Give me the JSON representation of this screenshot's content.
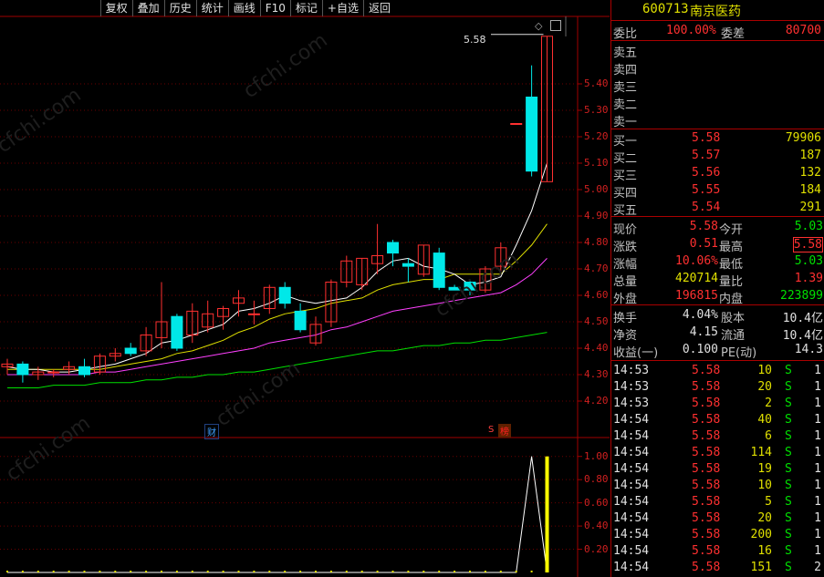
{
  "toolbar": {
    "items": [
      "复权",
      "叠加",
      "历史",
      "统计",
      "画线",
      "F10",
      "标记",
      "+自选",
      "返回"
    ]
  },
  "price_axis": [
    "5.40",
    "5.30",
    "5.20",
    "5.10",
    "5.00",
    "4.90",
    "4.80",
    "4.70",
    "4.60",
    "4.50",
    "4.40",
    "4.30",
    "4.20"
  ],
  "volume_axis": [
    "1.00",
    "0.80",
    "0.60",
    "0.40",
    "0.20"
  ],
  "price_marker": "5.58",
  "event_markers": {
    "fin": "财",
    "s": "S",
    "bang": "榜"
  },
  "watermark": "cfchi.com",
  "stock": {
    "code": "600713",
    "name": "南京医药"
  },
  "order_ratio": {
    "label_ratio": "委比",
    "ratio": "100.00%",
    "label_diff": "委差",
    "diff": "80700"
  },
  "sell_book": [
    {
      "label": "卖五",
      "price": "",
      "qty": ""
    },
    {
      "label": "卖四",
      "price": "",
      "qty": ""
    },
    {
      "label": "卖三",
      "price": "",
      "qty": ""
    },
    {
      "label": "卖二",
      "price": "",
      "qty": ""
    },
    {
      "label": "卖一",
      "price": "",
      "qty": ""
    }
  ],
  "buy_book": [
    {
      "label": "买一",
      "price": "5.58",
      "qty": "79906"
    },
    {
      "label": "买二",
      "price": "5.57",
      "qty": "187"
    },
    {
      "label": "买三",
      "price": "5.56",
      "qty": "132"
    },
    {
      "label": "买四",
      "price": "5.55",
      "qty": "184"
    },
    {
      "label": "买五",
      "price": "5.54",
      "qty": "291"
    }
  ],
  "quote": [
    {
      "l1": "现价",
      "v1": "5.58",
      "l2": "今开",
      "v2": "5.03",
      "c1": "#ff3030",
      "c2": "#00e000"
    },
    {
      "l1": "涨跌",
      "v1": "0.51",
      "l2": "最高",
      "v2": "5.58",
      "c1": "#ff3030",
      "c2": "#ff3030"
    },
    {
      "l1": "涨幅",
      "v1": "10.06%",
      "l2": "最低",
      "v2": "5.03",
      "c1": "#ff3030",
      "c2": "#00e000"
    },
    {
      "l1": "总量",
      "v1": "420714",
      "l2": "量比",
      "v2": "1.39",
      "c1": "#e0e000",
      "c2": "#ff3030"
    },
    {
      "l1": "外盘",
      "v1": "196815",
      "l2": "内盘",
      "v2": "223899",
      "c1": "#ff3030",
      "c2": "#00e000"
    }
  ],
  "fundamentals": [
    {
      "l1": "换手",
      "v1": "4.04%",
      "l2": "股本",
      "v2": "10.4亿"
    },
    {
      "l1": "净资",
      "v1": "4.15",
      "l2": "流通",
      "v2": "10.4亿"
    },
    {
      "l1": "收益(一)",
      "v1": "0.100",
      "l2": "PE(动)",
      "v2": "14.3"
    }
  ],
  "ticks": [
    {
      "time": "14:53",
      "price": "5.58",
      "vol": "10",
      "side": "S",
      "n": "1"
    },
    {
      "time": "14:53",
      "price": "5.58",
      "vol": "20",
      "side": "S",
      "n": "1"
    },
    {
      "time": "14:53",
      "price": "5.58",
      "vol": "2",
      "side": "S",
      "n": "1"
    },
    {
      "time": "14:54",
      "price": "5.58",
      "vol": "40",
      "side": "S",
      "n": "1"
    },
    {
      "time": "14:54",
      "price": "5.58",
      "vol": "6",
      "side": "S",
      "n": "1"
    },
    {
      "time": "14:54",
      "price": "5.58",
      "vol": "114",
      "side": "S",
      "n": "1"
    },
    {
      "time": "14:54",
      "price": "5.58",
      "vol": "19",
      "side": "S",
      "n": "1"
    },
    {
      "time": "14:54",
      "price": "5.58",
      "vol": "10",
      "side": "S",
      "n": "1"
    },
    {
      "time": "14:54",
      "price": "5.58",
      "vol": "5",
      "side": "S",
      "n": "1"
    },
    {
      "time": "14:54",
      "price": "5.58",
      "vol": "20",
      "side": "S",
      "n": "1"
    },
    {
      "time": "14:54",
      "price": "5.58",
      "vol": "200",
      "side": "S",
      "n": "1"
    },
    {
      "time": "14:54",
      "price": "5.58",
      "vol": "16",
      "side": "S",
      "n": "1"
    },
    {
      "time": "14:54",
      "price": "5.58",
      "vol": "151",
      "side": "S",
      "n": "2"
    }
  ],
  "colors": {
    "up": "#ff3030",
    "down": "#00e8e8",
    "ma5": "#ffffff",
    "ma10": "#e0e000",
    "ma20": "#ff40ff",
    "ma60": "#00e000",
    "frame": "#a00000"
  },
  "chart_data": {
    "type": "candlestick",
    "ylim": [
      4.18,
      5.62
    ],
    "candles": [
      {
        "o": 4.33,
        "h": 4.36,
        "l": 4.3,
        "c": 4.34
      },
      {
        "o": 4.34,
        "h": 4.35,
        "l": 4.27,
        "c": 4.3
      },
      {
        "o": 4.3,
        "h": 4.33,
        "l": 4.28,
        "c": 4.31
      },
      {
        "o": 4.31,
        "h": 4.32,
        "l": 4.29,
        "c": 4.31
      },
      {
        "o": 4.32,
        "h": 4.35,
        "l": 4.3,
        "c": 4.33
      },
      {
        "o": 4.33,
        "h": 4.36,
        "l": 4.29,
        "c": 4.3
      },
      {
        "o": 4.31,
        "h": 4.38,
        "l": 4.3,
        "c": 4.37
      },
      {
        "o": 4.37,
        "h": 4.4,
        "l": 4.35,
        "c": 4.38
      },
      {
        "o": 4.4,
        "h": 4.42,
        "l": 4.37,
        "c": 4.38
      },
      {
        "o": 4.39,
        "h": 4.48,
        "l": 4.37,
        "c": 4.45
      },
      {
        "o": 4.44,
        "h": 4.65,
        "l": 4.4,
        "c": 4.5
      },
      {
        "o": 4.52,
        "h": 4.53,
        "l": 4.39,
        "c": 4.4
      },
      {
        "o": 4.45,
        "h": 4.57,
        "l": 4.42,
        "c": 4.54
      },
      {
        "o": 4.48,
        "h": 4.58,
        "l": 4.46,
        "c": 4.53
      },
      {
        "o": 4.52,
        "h": 4.56,
        "l": 4.47,
        "c": 4.55
      },
      {
        "o": 4.57,
        "h": 4.62,
        "l": 4.52,
        "c": 4.59
      },
      {
        "o": 4.53,
        "h": 4.58,
        "l": 4.49,
        "c": 4.53
      },
      {
        "o": 4.55,
        "h": 4.64,
        "l": 4.53,
        "c": 4.63
      },
      {
        "o": 4.63,
        "h": 4.65,
        "l": 4.55,
        "c": 4.57
      },
      {
        "o": 4.54,
        "h": 4.57,
        "l": 4.46,
        "c": 4.47
      },
      {
        "o": 4.42,
        "h": 4.52,
        "l": 4.41,
        "c": 4.49
      },
      {
        "o": 4.5,
        "h": 4.66,
        "l": 4.48,
        "c": 4.65
      },
      {
        "o": 4.65,
        "h": 4.75,
        "l": 4.63,
        "c": 4.73
      },
      {
        "o": 4.64,
        "h": 4.74,
        "l": 4.62,
        "c": 4.74
      },
      {
        "o": 4.72,
        "h": 4.87,
        "l": 4.68,
        "c": 4.75
      },
      {
        "o": 4.8,
        "h": 4.81,
        "l": 4.71,
        "c": 4.76
      },
      {
        "o": 4.72,
        "h": 4.74,
        "l": 4.65,
        "c": 4.71
      },
      {
        "o": 4.68,
        "h": 4.79,
        "l": 4.67,
        "c": 4.79
      },
      {
        "o": 4.76,
        "h": 4.78,
        "l": 4.62,
        "c": 4.63
      },
      {
        "o": 4.63,
        "h": 4.64,
        "l": 4.62,
        "c": 4.62
      },
      {
        "o": 4.65,
        "h": 4.66,
        "l": 4.6,
        "c": 4.62
      },
      {
        "o": 4.62,
        "h": 4.71,
        "l": 4.61,
        "c": 4.7
      },
      {
        "o": 4.71,
        "h": 4.8,
        "l": 4.68,
        "c": 4.78
      },
      {
        "o": 5.25,
        "h": 5.25,
        "l": 5.25,
        "c": 5.25
      },
      {
        "o": 5.35,
        "h": 5.47,
        "l": 5.05,
        "c": 5.07
      },
      {
        "o": 5.03,
        "h": 5.58,
        "l": 5.03,
        "c": 5.58
      }
    ],
    "ma5": [
      4.33,
      4.32,
      4.32,
      4.31,
      4.31,
      4.32,
      4.33,
      4.34,
      4.36,
      4.38,
      4.42,
      4.43,
      4.45,
      4.47,
      4.49,
      4.54,
      4.55,
      4.57,
      4.6,
      4.58,
      4.57,
      4.58,
      4.59,
      4.63,
      4.69,
      4.73,
      4.74,
      4.71,
      4.7,
      4.68,
      4.64,
      4.65,
      4.67,
      4.79,
      4.92,
      5.1
    ],
    "ma10": [
      4.32,
      4.32,
      4.32,
      4.32,
      4.32,
      4.32,
      4.32,
      4.33,
      4.34,
      4.35,
      4.36,
      4.38,
      4.39,
      4.41,
      4.43,
      4.46,
      4.48,
      4.51,
      4.53,
      4.54,
      4.55,
      4.57,
      4.58,
      4.59,
      4.62,
      4.64,
      4.65,
      4.66,
      4.66,
      4.68,
      4.68,
      4.68,
      4.68,
      4.73,
      4.79,
      4.87
    ],
    "ma20": [
      4.3,
      4.3,
      4.3,
      4.3,
      4.3,
      4.3,
      4.31,
      4.31,
      4.32,
      4.33,
      4.34,
      4.35,
      4.36,
      4.37,
      4.38,
      4.39,
      4.4,
      4.42,
      4.43,
      4.44,
      4.45,
      4.47,
      4.48,
      4.5,
      4.52,
      4.54,
      4.55,
      4.56,
      4.57,
      4.58,
      4.59,
      4.6,
      4.61,
      4.64,
      4.68,
      4.74
    ],
    "ma60": [
      4.25,
      4.25,
      4.25,
      4.26,
      4.26,
      4.26,
      4.27,
      4.27,
      4.27,
      4.28,
      4.28,
      4.29,
      4.29,
      4.3,
      4.3,
      4.31,
      4.31,
      4.32,
      4.33,
      4.34,
      4.35,
      4.36,
      4.37,
      4.38,
      4.39,
      4.39,
      4.4,
      4.41,
      4.41,
      4.42,
      4.42,
      4.43,
      4.43,
      4.44,
      4.45,
      4.46
    ],
    "volume_line": [
      0,
      0,
      0,
      0,
      0,
      0,
      0,
      0,
      0,
      0,
      0,
      0,
      0,
      0,
      0,
      0,
      0,
      0,
      0,
      0,
      0,
      0,
      0,
      0,
      0,
      0,
      0,
      0,
      0,
      0,
      0,
      0,
      0,
      0,
      1.0,
      0
    ],
    "volume_bar": {
      "index": 35,
      "value": 1.0
    },
    "volume_ylim": [
      0,
      1.1
    ]
  }
}
